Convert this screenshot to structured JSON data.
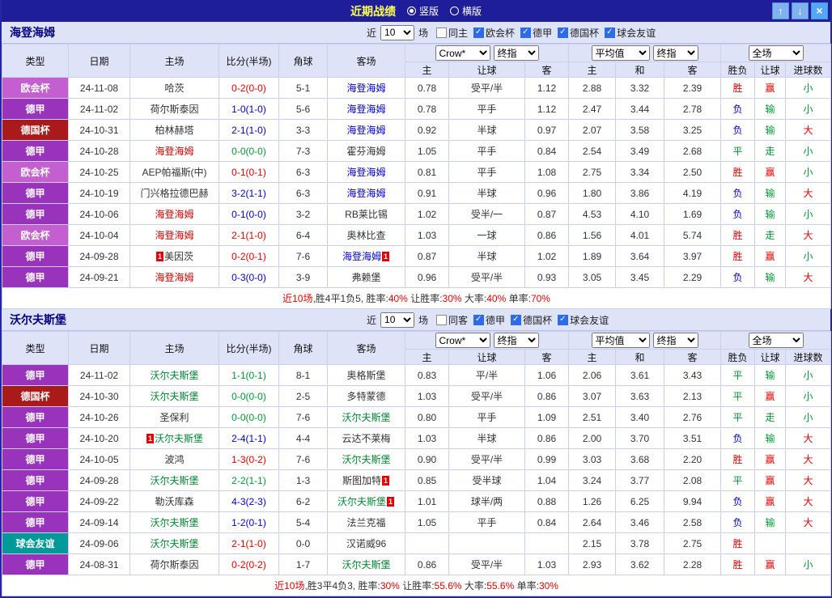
{
  "titlebar": {
    "title": "近期战绩",
    "vertical_label": "竖版",
    "horizontal_label": "横版",
    "up_icon": "↑",
    "down_icon": "↓",
    "close_icon": "×",
    "bar_color": "#1e1e9b",
    "button_color": "#7fb2ef",
    "close_color": "#52a8f7"
  },
  "misc": {
    "red_card": "1"
  },
  "colors": {
    "win": "#e60000",
    "draw": "#009933",
    "loss": "#0000cc",
    "header_bg": "#dfe3f7",
    "grid_line": "#c9d0ee"
  },
  "table_header": {
    "type": "类型",
    "date": "日期",
    "home": "主场",
    "score": "比分(半场)",
    "corners": "角球",
    "away": "客场",
    "ah_home": "主",
    "ah_line": "让球",
    "ah_away": "客",
    "eu_home": "主",
    "eu_draw": "和",
    "eu_away": "客",
    "result": "胜负",
    "handicap": "让球",
    "goals": "进球数"
  },
  "sections": [
    {
      "team": "海登海姆",
      "near_label": "近",
      "count_value": "10",
      "unit_label": "场",
      "filters": [
        {
          "label": "同主",
          "checked": false
        },
        {
          "label": "欧会杯",
          "checked": true
        },
        {
          "label": "德甲",
          "checked": true
        },
        {
          "label": "德国杯",
          "checked": true
        },
        {
          "label": "球会友谊",
          "checked": true
        }
      ],
      "company_select": "Crow*",
      "company_index_select": "终指",
      "avg_select": "平均值",
      "avg_index_select": "终指",
      "scope_select": "全场",
      "rows": [
        {
          "league": "欧会杯",
          "league_color": "#c45fd0",
          "date": "24-11-08",
          "home": "哈茨",
          "home_color": "#333333",
          "home_badge": false,
          "score": "0-2(0-0)",
          "score_color": "#e60000",
          "corners": "5-1",
          "away": "海登海姆",
          "away_color": "#0000cc",
          "away_badge": false,
          "ah_home": "0.78",
          "ah_line": "受平/半",
          "ah_away": "1.12",
          "eu_home": "2.88",
          "eu_draw": "3.32",
          "eu_away": "2.39",
          "result": "胜",
          "result_color": "#e60000",
          "ah_result": "赢",
          "ah_result_color": "#e60000",
          "goals": "小",
          "goals_color": "#009933"
        },
        {
          "league": "德甲",
          "league_color": "#9933bb",
          "date": "24-11-02",
          "home": "荷尔斯泰因",
          "home_color": "#333333",
          "home_badge": false,
          "score": "1-0(1-0)",
          "score_color": "#0000cc",
          "corners": "5-6",
          "away": "海登海姆",
          "away_color": "#0000cc",
          "away_badge": false,
          "ah_home": "0.78",
          "ah_line": "平手",
          "ah_away": "1.12",
          "eu_home": "2.47",
          "eu_draw": "3.44",
          "eu_away": "2.78",
          "result": "负",
          "result_color": "#0000cc",
          "ah_result": "输",
          "ah_result_color": "#009933",
          "goals": "小",
          "goals_color": "#009933"
        },
        {
          "league": "德国杯",
          "league_color": "#aa1a1a",
          "date": "24-10-31",
          "home": "柏林赫塔",
          "home_color": "#333333",
          "home_badge": false,
          "score": "2-1(1-0)",
          "score_color": "#0000cc",
          "corners": "3-3",
          "away": "海登海姆",
          "away_color": "#0000cc",
          "away_badge": false,
          "ah_home": "0.92",
          "ah_line": "半球",
          "ah_away": "0.97",
          "eu_home": "2.07",
          "eu_draw": "3.58",
          "eu_away": "3.25",
          "result": "负",
          "result_color": "#0000cc",
          "ah_result": "输",
          "ah_result_color": "#009933",
          "goals": "大",
          "goals_color": "#e60000"
        },
        {
          "league": "德甲",
          "league_color": "#9933bb",
          "date": "24-10-28",
          "home": "海登海姆",
          "home_color": "#dd0000",
          "home_badge": false,
          "score": "0-0(0-0)",
          "score_color": "#009933",
          "corners": "7-3",
          "away": "霍芬海姆",
          "away_color": "#333333",
          "away_badge": false,
          "ah_home": "1.05",
          "ah_line": "平手",
          "ah_away": "0.84",
          "eu_home": "2.54",
          "eu_draw": "3.49",
          "eu_away": "2.68",
          "result": "平",
          "result_color": "#009933",
          "ah_result": "走",
          "ah_result_color": "#009933",
          "goals": "小",
          "goals_color": "#009933"
        },
        {
          "league": "欧会杯",
          "league_color": "#c45fd0",
          "date": "24-10-25",
          "home": "AEP帕福斯(中)",
          "home_color": "#333333",
          "home_badge": false,
          "score": "0-1(0-1)",
          "score_color": "#e60000",
          "corners": "6-3",
          "away": "海登海姆",
          "away_color": "#0000cc",
          "away_badge": false,
          "ah_home": "0.81",
          "ah_line": "平手",
          "ah_away": "1.08",
          "eu_home": "2.75",
          "eu_draw": "3.34",
          "eu_away": "2.50",
          "result": "胜",
          "result_color": "#e60000",
          "ah_result": "赢",
          "ah_result_color": "#e60000",
          "goals": "小",
          "goals_color": "#009933"
        },
        {
          "league": "德甲",
          "league_color": "#9933bb",
          "date": "24-10-19",
          "home": "门兴格拉德巴赫",
          "home_color": "#333333",
          "home_badge": false,
          "score": "3-2(1-1)",
          "score_color": "#0000cc",
          "corners": "6-3",
          "away": "海登海姆",
          "away_color": "#0000cc",
          "away_badge": false,
          "ah_home": "0.91",
          "ah_line": "半球",
          "ah_away": "0.96",
          "eu_home": "1.80",
          "eu_draw": "3.86",
          "eu_away": "4.19",
          "result": "负",
          "result_color": "#0000cc",
          "ah_result": "输",
          "ah_result_color": "#009933",
          "goals": "大",
          "goals_color": "#e60000"
        },
        {
          "league": "德甲",
          "league_color": "#9933bb",
          "date": "24-10-06",
          "home": "海登海姆",
          "home_color": "#dd0000",
          "home_badge": false,
          "score": "0-1(0-0)",
          "score_color": "#0000cc",
          "corners": "3-2",
          "away": "RB莱比锡",
          "away_color": "#333333",
          "away_badge": false,
          "ah_home": "1.02",
          "ah_line": "受半/一",
          "ah_away": "0.87",
          "eu_home": "4.53",
          "eu_draw": "4.10",
          "eu_away": "1.69",
          "result": "负",
          "result_color": "#0000cc",
          "ah_result": "输",
          "ah_result_color": "#009933",
          "goals": "小",
          "goals_color": "#009933"
        },
        {
          "league": "欧会杯",
          "league_color": "#c45fd0",
          "date": "24-10-04",
          "home": "海登海姆",
          "home_color": "#dd0000",
          "home_badge": false,
          "score": "2-1(1-0)",
          "score_color": "#e60000",
          "corners": "6-4",
          "away": "奥林比查",
          "away_color": "#333333",
          "away_badge": false,
          "ah_home": "1.03",
          "ah_line": "一球",
          "ah_away": "0.86",
          "eu_home": "1.56",
          "eu_draw": "4.01",
          "eu_away": "5.74",
          "result": "胜",
          "result_color": "#e60000",
          "ah_result": "走",
          "ah_result_color": "#009933",
          "goals": "大",
          "goals_color": "#e60000"
        },
        {
          "league": "德甲",
          "league_color": "#9933bb",
          "date": "24-09-28",
          "home": "美因茨",
          "home_color": "#333333",
          "home_badge": true,
          "score": "0-2(0-1)",
          "score_color": "#e60000",
          "corners": "7-6",
          "away": "海登海姆",
          "away_color": "#0000cc",
          "away_badge": true,
          "ah_home": "0.87",
          "ah_line": "半球",
          "ah_away": "1.02",
          "eu_home": "1.89",
          "eu_draw": "3.64",
          "eu_away": "3.97",
          "result": "胜",
          "result_color": "#e60000",
          "ah_result": "赢",
          "ah_result_color": "#e60000",
          "goals": "小",
          "goals_color": "#009933"
        },
        {
          "league": "德甲",
          "league_color": "#9933bb",
          "date": "24-09-21",
          "home": "海登海姆",
          "home_color": "#dd0000",
          "home_badge": false,
          "score": "0-3(0-0)",
          "score_color": "#0000cc",
          "corners": "3-9",
          "away": "弗赖堡",
          "away_color": "#333333",
          "away_badge": false,
          "ah_home": "0.96",
          "ah_line": "受平/半",
          "ah_away": "0.93",
          "eu_home": "3.05",
          "eu_draw": "3.45",
          "eu_away": "2.29",
          "result": "负",
          "result_color": "#0000cc",
          "ah_result": "输",
          "ah_result_color": "#009933",
          "goals": "大",
          "goals_color": "#e60000"
        }
      ],
      "summary": [
        {
          "t": "近10场",
          "c": "#e60000"
        },
        {
          "t": ",胜4平1负5, ",
          "c": "#333333"
        },
        {
          "t": "胜率:",
          "c": "#333333"
        },
        {
          "t": "40%",
          "c": "#e60000"
        },
        {
          "t": " 让胜率:",
          "c": "#333333"
        },
        {
          "t": "30%",
          "c": "#e60000"
        },
        {
          "t": " 大率:",
          "c": "#333333"
        },
        {
          "t": "40%",
          "c": "#e60000"
        },
        {
          "t": " 单率:",
          "c": "#333333"
        },
        {
          "t": "70%",
          "c": "#e60000"
        }
      ]
    },
    {
      "team": "沃尔夫斯堡",
      "near_label": "近",
      "count_value": "10",
      "unit_label": "场",
      "filters": [
        {
          "label": "同客",
          "checked": false
        },
        {
          "label": "德甲",
          "checked": true
        },
        {
          "label": "德国杯",
          "checked": true
        },
        {
          "label": "球会友谊",
          "checked": true
        }
      ],
      "company_select": "Crow*",
      "company_index_select": "终指",
      "avg_select": "平均值",
      "avg_index_select": "终指",
      "scope_select": "全场",
      "rows": [
        {
          "league": "德甲",
          "league_color": "#9933bb",
          "date": "24-11-02",
          "home": "沃尔夫斯堡",
          "home_color": "#008833",
          "home_badge": false,
          "score": "1-1(0-1)",
          "score_color": "#009933",
          "corners": "8-1",
          "away": "奥格斯堡",
          "away_color": "#333333",
          "away_badge": false,
          "ah_home": "0.83",
          "ah_line": "平/半",
          "ah_away": "1.06",
          "eu_home": "2.06",
          "eu_draw": "3.61",
          "eu_away": "3.43",
          "result": "平",
          "result_color": "#009933",
          "ah_result": "输",
          "ah_result_color": "#009933",
          "goals": "小",
          "goals_color": "#009933"
        },
        {
          "league": "德国杯",
          "league_color": "#aa1a1a",
          "date": "24-10-30",
          "home": "沃尔夫斯堡",
          "home_color": "#008833",
          "home_badge": false,
          "score": "0-0(0-0)",
          "score_color": "#009933",
          "corners": "2-5",
          "away": "多特蒙德",
          "away_color": "#333333",
          "away_badge": false,
          "ah_home": "1.03",
          "ah_line": "受平/半",
          "ah_away": "0.86",
          "eu_home": "3.07",
          "eu_draw": "3.63",
          "eu_away": "2.13",
          "result": "平",
          "result_color": "#009933",
          "ah_result": "赢",
          "ah_result_color": "#e60000",
          "goals": "小",
          "goals_color": "#009933"
        },
        {
          "league": "德甲",
          "league_color": "#9933bb",
          "date": "24-10-26",
          "home": "圣保利",
          "home_color": "#333333",
          "home_badge": false,
          "score": "0-0(0-0)",
          "score_color": "#009933",
          "corners": "7-6",
          "away": "沃尔夫斯堡",
          "away_color": "#008833",
          "away_badge": false,
          "ah_home": "0.80",
          "ah_line": "平手",
          "ah_away": "1.09",
          "eu_home": "2.51",
          "eu_draw": "3.40",
          "eu_away": "2.76",
          "result": "平",
          "result_color": "#009933",
          "ah_result": "走",
          "ah_result_color": "#009933",
          "goals": "小",
          "goals_color": "#009933"
        },
        {
          "league": "德甲",
          "league_color": "#9933bb",
          "date": "24-10-20",
          "home": "沃尔夫斯堡",
          "home_color": "#008833",
          "home_badge": true,
          "score": "2-4(1-1)",
          "score_color": "#0000cc",
          "corners": "4-4",
          "away": "云达不莱梅",
          "away_color": "#333333",
          "away_badge": false,
          "ah_home": "1.03",
          "ah_line": "半球",
          "ah_away": "0.86",
          "eu_home": "2.00",
          "eu_draw": "3.70",
          "eu_away": "3.51",
          "result": "负",
          "result_color": "#0000cc",
          "ah_result": "输",
          "ah_result_color": "#009933",
          "goals": "大",
          "goals_color": "#e60000"
        },
        {
          "league": "德甲",
          "league_color": "#9933bb",
          "date": "24-10-05",
          "home": "波鸿",
          "home_color": "#333333",
          "home_badge": false,
          "score": "1-3(0-2)",
          "score_color": "#e60000",
          "corners": "7-6",
          "away": "沃尔夫斯堡",
          "away_color": "#008833",
          "away_badge": false,
          "ah_home": "0.90",
          "ah_line": "受平/半",
          "ah_away": "0.99",
          "eu_home": "3.03",
          "eu_draw": "3.68",
          "eu_away": "2.20",
          "result": "胜",
          "result_color": "#e60000",
          "ah_result": "赢",
          "ah_result_color": "#e60000",
          "goals": "大",
          "goals_color": "#e60000"
        },
        {
          "league": "德甲",
          "league_color": "#9933bb",
          "date": "24-09-28",
          "home": "沃尔夫斯堡",
          "home_color": "#008833",
          "home_badge": false,
          "score": "2-2(1-1)",
          "score_color": "#009933",
          "corners": "1-3",
          "away": "斯图加特",
          "away_color": "#333333",
          "away_badge": true,
          "ah_home": "0.85",
          "ah_line": "受半球",
          "ah_away": "1.04",
          "eu_home": "3.24",
          "eu_draw": "3.77",
          "eu_away": "2.08",
          "result": "平",
          "result_color": "#009933",
          "ah_result": "赢",
          "ah_result_color": "#e60000",
          "goals": "大",
          "goals_color": "#e60000"
        },
        {
          "league": "德甲",
          "league_color": "#9933bb",
          "date": "24-09-22",
          "home": "勒沃库森",
          "home_color": "#333333",
          "home_badge": false,
          "score": "4-3(2-3)",
          "score_color": "#0000cc",
          "corners": "6-2",
          "away": "沃尔夫斯堡",
          "away_color": "#008833",
          "away_badge": true,
          "ah_home": "1.01",
          "ah_line": "球半/两",
          "ah_away": "0.88",
          "eu_home": "1.26",
          "eu_draw": "6.25",
          "eu_away": "9.94",
          "result": "负",
          "result_color": "#0000cc",
          "ah_result": "赢",
          "ah_result_color": "#e60000",
          "goals": "大",
          "goals_color": "#e60000"
        },
        {
          "league": "德甲",
          "league_color": "#9933bb",
          "date": "24-09-14",
          "home": "沃尔夫斯堡",
          "home_color": "#008833",
          "home_badge": false,
          "score": "1-2(0-1)",
          "score_color": "#0000cc",
          "corners": "5-4",
          "away": "法兰克福",
          "away_color": "#333333",
          "away_badge": false,
          "ah_home": "1.05",
          "ah_line": "平手",
          "ah_away": "0.84",
          "eu_home": "2.64",
          "eu_draw": "3.46",
          "eu_away": "2.58",
          "result": "负",
          "result_color": "#0000cc",
          "ah_result": "输",
          "ah_result_color": "#009933",
          "goals": "大",
          "goals_color": "#e60000"
        },
        {
          "league": "球会友谊",
          "league_color": "#009999",
          "date": "24-09-06",
          "home": "沃尔夫斯堡",
          "home_color": "#008833",
          "home_badge": false,
          "score": "2-1(1-0)",
          "score_color": "#e60000",
          "corners": "0-0",
          "away": "汉诺威96",
          "away_color": "#333333",
          "away_badge": false,
          "ah_home": "",
          "ah_line": "",
          "ah_away": "",
          "eu_home": "2.15",
          "eu_draw": "3.78",
          "eu_away": "2.75",
          "result": "胜",
          "result_color": "#e60000",
          "ah_result": "",
          "ah_result_color": "#333333",
          "goals": "",
          "goals_color": "#333333"
        },
        {
          "league": "德甲",
          "league_color": "#9933bb",
          "date": "24-08-31",
          "home": "荷尔斯泰因",
          "home_color": "#333333",
          "home_badge": false,
          "score": "0-2(0-2)",
          "score_color": "#e60000",
          "corners": "1-7",
          "away": "沃尔夫斯堡",
          "away_color": "#008833",
          "away_badge": false,
          "ah_home": "0.86",
          "ah_line": "受平/半",
          "ah_away": "1.03",
          "eu_home": "2.93",
          "eu_draw": "3.62",
          "eu_away": "2.28",
          "result": "胜",
          "result_color": "#e60000",
          "ah_result": "赢",
          "ah_result_color": "#e60000",
          "goals": "小",
          "goals_color": "#009933"
        }
      ],
      "summary": [
        {
          "t": "近10场",
          "c": "#e60000"
        },
        {
          "t": ",胜3平4负3, ",
          "c": "#333333"
        },
        {
          "t": "胜率:",
          "c": "#333333"
        },
        {
          "t": "30%",
          "c": "#e60000"
        },
        {
          "t": " 让胜率:",
          "c": "#333333"
        },
        {
          "t": "55.6%",
          "c": "#e60000"
        },
        {
          "t": " 大率:",
          "c": "#333333"
        },
        {
          "t": "55.6%",
          "c": "#e60000"
        },
        {
          "t": " 单率:",
          "c": "#333333"
        },
        {
          "t": "30%",
          "c": "#e60000"
        }
      ]
    }
  ]
}
